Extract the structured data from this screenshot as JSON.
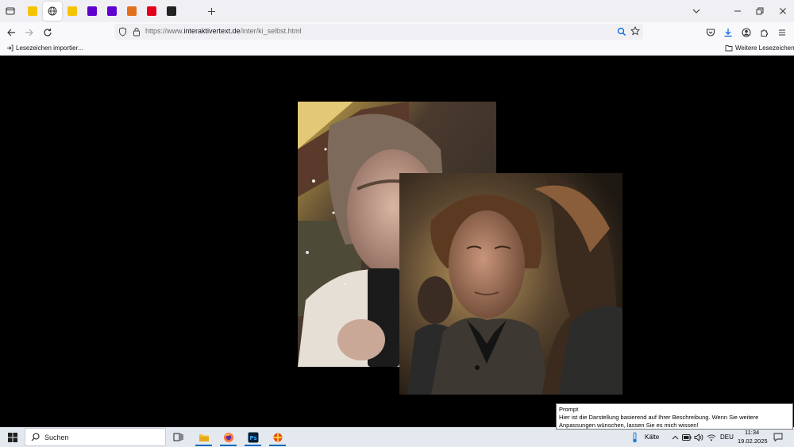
{
  "browser": {
    "url_scheme": "https://www.",
    "url_host": "interaktivertext.de",
    "url_path": "/inter/ki_selbst.html",
    "tabs": [
      {
        "favicon": "yellow-badge",
        "letter": "M",
        "color": "#f5c400",
        "active": false
      },
      {
        "favicon": "globe-icon",
        "letter": "",
        "color": "#333333",
        "active": true
      },
      {
        "favicon": "yellow-badge",
        "letter": "M",
        "color": "#f5c400",
        "active": false
      },
      {
        "favicon": "yahoo-icon",
        "letter": "y!",
        "color": "#6001d2",
        "active": false
      },
      {
        "favicon": "yahoo-icon",
        "letter": "y!",
        "color": "#6001d2",
        "active": false
      },
      {
        "favicon": "colorful-icon",
        "letter": "R",
        "color": "#e2711d",
        "active": false
      },
      {
        "favicon": "red-f-icon",
        "letter": "F",
        "color": "#e2001a",
        "active": false
      },
      {
        "favicon": "dark-square-icon",
        "letter": "D",
        "color": "#222222",
        "active": false
      }
    ]
  },
  "bookmarks": {
    "import_label": "Lesezeichen importier...",
    "more_label": "Weitere Lesezeichen"
  },
  "tooltip": {
    "title": "Prompt",
    "text": "Hier ist die Darstellung basierend auf Ihrer Beschreibung. Wenn Sie weitere Anpassungen wünschen, lassen Sie es mich wissen!"
  },
  "taskbar": {
    "search_label": "Suchen",
    "weather_label": "Kälte",
    "language": "DEU",
    "time": "11:34",
    "date": "19.02.2025"
  },
  "colors": {
    "tab_bg": "#f0f0f4",
    "toolbar_bg": "#f9f9fb",
    "taskbar_bg": "#e4e9ef",
    "accent": "#0067c0"
  }
}
